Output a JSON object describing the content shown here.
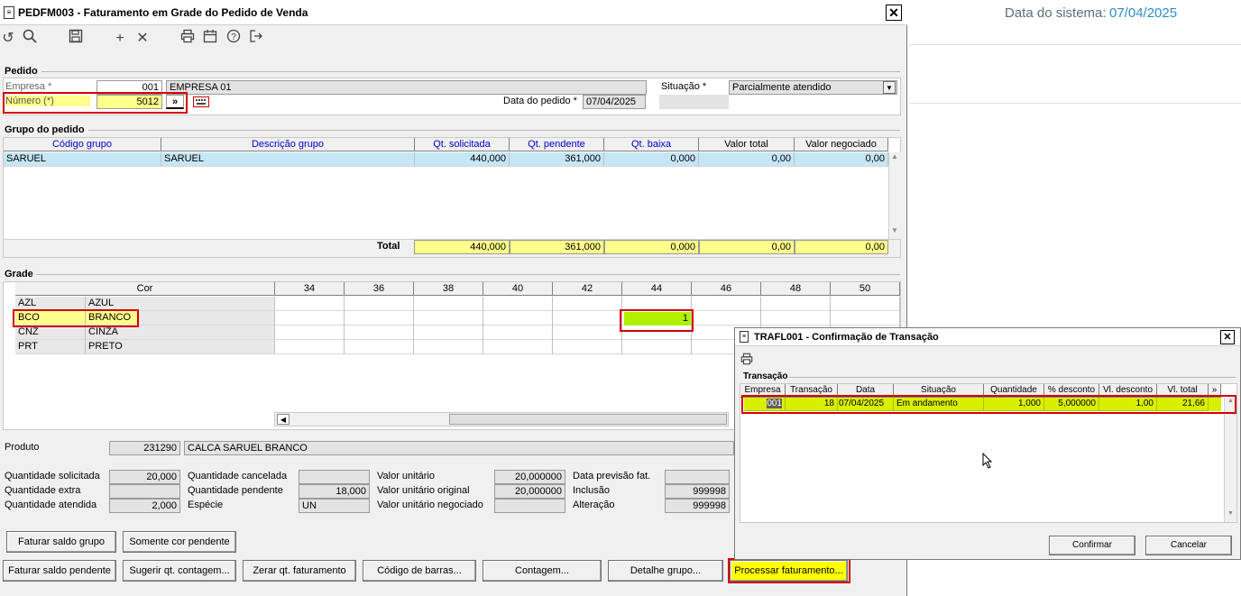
{
  "main_window": {
    "title": "PEDFM003 - Faturamento em Grade do Pedido de Venda",
    "close_glyph": "✕"
  },
  "toolbar": {
    "icons": [
      "refresh-icon",
      "search-icon",
      "save-icon",
      "add-icon",
      "delete-icon",
      "print-icon",
      "calendar-icon",
      "help-icon",
      "exit-icon"
    ]
  },
  "system_date": {
    "label": "Data do sistema:",
    "value": "07/04/2025"
  },
  "pedido": {
    "section_title": "Pedido",
    "empresa_label": "Empresa *",
    "empresa_code": "001",
    "empresa_name": "EMPRESA 01",
    "numero_label": "Número (*)",
    "numero_value": "5012",
    "numero_button": "»",
    "data_label": "Data do pedido *",
    "data_value": "07/04/2025",
    "situacao_label": "Situação *",
    "situacao_value": "Parcialmente atendido"
  },
  "grupo": {
    "section_title": "Grupo do pedido",
    "headers": [
      "Código grupo",
      "Descrição grupo",
      "Qt. solicitada",
      "Qt. pendente",
      "Qt. baixa",
      "Valor total",
      "Valor  negociado"
    ],
    "row": [
      "SARUEL",
      "SARUEL",
      "440,000",
      "361,000",
      "0,000",
      "0,00",
      "0,00"
    ],
    "total_label": "Total",
    "totals": [
      "440,000",
      "361,000",
      "0,000",
      "0,00",
      "0,00"
    ]
  },
  "grade": {
    "section_title": "Grade",
    "cor_header": "Cor",
    "sizes": [
      "34",
      "36",
      "38",
      "40",
      "42",
      "44",
      "46",
      "48",
      "50"
    ],
    "rows": [
      {
        "code": "AZL",
        "name": "AZUL"
      },
      {
        "code": "BCO",
        "name": "BRANCO"
      },
      {
        "code": "CNZ",
        "name": "CINZA"
      },
      {
        "code": "PRT",
        "name": "PRETO"
      }
    ],
    "entered_qty": "1"
  },
  "produto": {
    "label": "Produto",
    "code": "231290",
    "name": "CALCA SARUEL BRANCO"
  },
  "quantidades": {
    "solicitada_label": "Quantidade solicitada",
    "solicitada": "20,000",
    "extra_label": "Quantidade extra",
    "extra": "",
    "atendida_label": "Quantidade atendida",
    "atendida": "2,000",
    "cancelada_label": "Quantidade cancelada",
    "cancelada": "",
    "pendente_label": "Quantidade pendente",
    "pendente": "18,000",
    "especie_label": "Espécie",
    "especie": "UN",
    "valor_unitario_label": "Valor unitário",
    "valor_unitario": "20,000000",
    "valor_original_label": "Valor unitário original",
    "valor_original": "20,000000",
    "valor_negociado_label": "Valor unitário negociado",
    "valor_negociado": "",
    "previsao_label": "Data previsão fat.",
    "previsao": "",
    "inclusao_label": "Inclusão",
    "inclusao": "999998",
    "alteracao_label": "Alteração",
    "alteracao": "999998"
  },
  "buttons": {
    "faturar_saldo_grupo": "Faturar saldo grupo",
    "somente_cor_pendente": "Somente cor pendente",
    "faturar_saldo_pendente": "Faturar saldo pendente",
    "sugerir_qt": "Sugerir qt. contagem...",
    "zerar_qt": "Zerar qt. faturamento",
    "codigo_barras": "Código de barras...",
    "contagem": "Contagem...",
    "detalhe_grupo": "Detalhe grupo...",
    "processar": "Processar faturamento..."
  },
  "dialog": {
    "title": "TRAFL001 - Confirmação de Transação",
    "close_glyph": "✕",
    "section_title": "Transação",
    "headers": [
      "Empresa",
      "Transação",
      "Data",
      "Situação",
      "Quantidade",
      "% desconto",
      "Vl. desconto",
      "Vl. total",
      "»"
    ],
    "row": [
      "001",
      "18",
      "07/04/2025",
      "Em andamento",
      "1,000",
      "5,000000",
      "1,00",
      "21,66"
    ],
    "confirmar": "Confirmar",
    "cancelar": "Cancelar"
  },
  "colors": {
    "highlight_yellow": "#ffff8c",
    "green_cell": "#b0f000",
    "annotation_red": "#d40000",
    "header_blue": "#0000cc",
    "date_blue": "#2a8fc4"
  }
}
